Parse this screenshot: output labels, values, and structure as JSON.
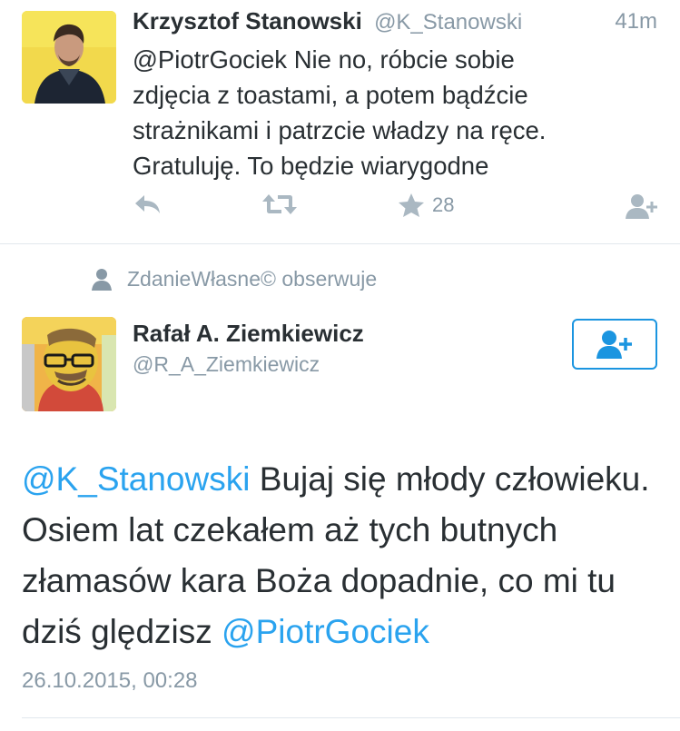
{
  "tweet1": {
    "author_name": "Krzysztof Stanowski",
    "author_handle": "@K_Stanowski",
    "time_ago": "41m",
    "text_line1": "@PiotrGociek Nie no, róbcie sobie",
    "text_line2": "zdjęcia z toastami, a potem bądźcie",
    "text_line3": "strażnikami i patrzcie władzy na ręce.",
    "text_line4": "Gratuluję. To będzie wiarygodne",
    "likes_count": "28",
    "icons": [
      "reply-icon",
      "retweet-icon",
      "star-icon",
      "follow-user-icon"
    ]
  },
  "social_context": {
    "text": "ZdanieWłasne© obserwuje",
    "icon": "person-icon"
  },
  "tweet2": {
    "author_name": "Rafał A. Ziemkiewicz",
    "author_handle": "@R_A_Ziemkiewicz",
    "mention1": "@K_Stanowski",
    "text_after_mention1": " Bujaj się młody człowieku. Osiem lat czekałem aż tych butnych złamasów kara Boża dopadnie, co mi tu dziś ględzisz ",
    "mention2": "@PiotrGociek",
    "date": "26.10.2015, 00:28",
    "follow_button_icon": "add-user-icon"
  },
  "colors": {
    "link": "#2aa3ef",
    "button_border": "#1b95e0",
    "secondary_text": "#8899a6",
    "action_icon": "#aab8c2",
    "avatar1_bg": "#f1d64a"
  }
}
